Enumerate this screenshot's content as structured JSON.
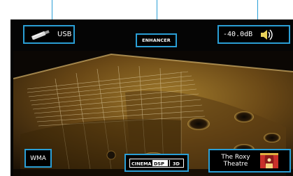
{
  "top_left": {
    "source_label": "USB",
    "source_icon": "usb-stick-icon"
  },
  "top_center": {
    "enhancer_label": "ENHANCER"
  },
  "top_right": {
    "volume_label": "-40.0dB",
    "volume_icon": "speaker-icon"
  },
  "bottom_left": {
    "codec_label": "WMA"
  },
  "bottom_center": {
    "mode_logo": "cinema-dsp-3d-logo",
    "mode_logo_text_a": "CINEMA",
    "mode_logo_text_b": "DSP",
    "mode_logo_text_c": "3D"
  },
  "bottom_right": {
    "program_line1": "The Roxy",
    "program_line2": "Theatre",
    "program_icon": "theatre-stage-icon"
  },
  "colors": {
    "frame_accent": "#2a9fd6",
    "osd_background": "#000000",
    "osd_text": "#ffffff"
  }
}
